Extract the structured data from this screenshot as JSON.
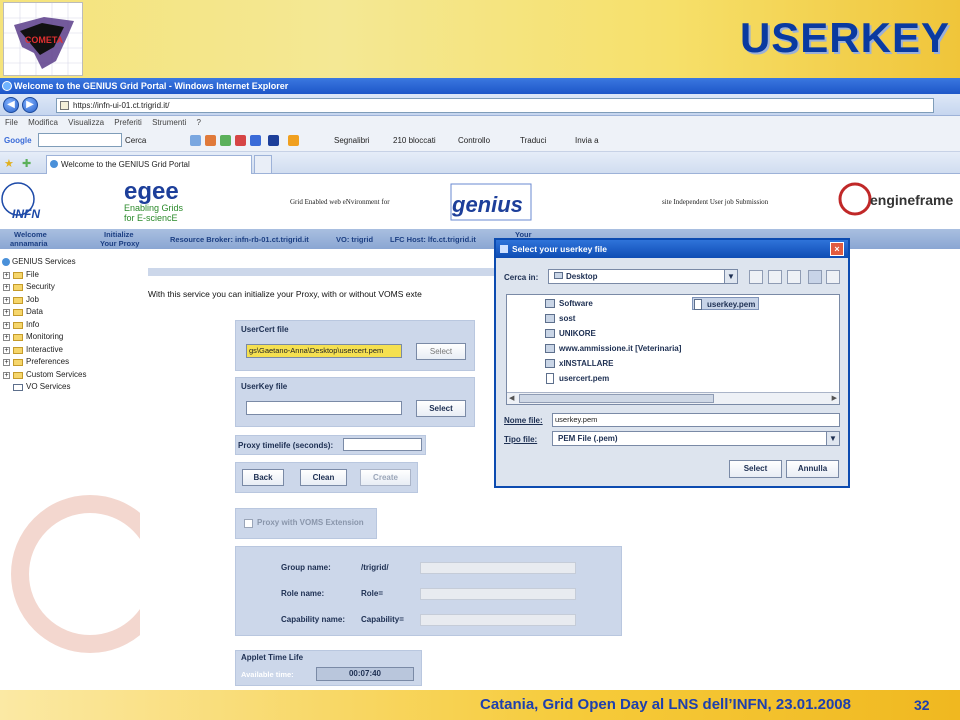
{
  "slide": {
    "title": "USERKEY",
    "footer": "Catania, Grid Open Day al LNS dell’INFN, 23.01.2008",
    "number": "32",
    "logo_text": "COMETA"
  },
  "browser": {
    "title": "Welcome to the GENIUS Grid Portal - Windows Internet Explorer",
    "url": "https://infn-ui-01.ct.trigrid.it/",
    "menu": [
      "File",
      "Modifica",
      "Visualizza",
      "Preferiti",
      "Strumenti",
      "?"
    ],
    "toolbar": {
      "google": "Google",
      "cerca": "Cerca",
      "segnalibri": "Segnalibri",
      "bloccati": "210 bloccati",
      "controllo": "Controllo",
      "traduci": "Traduci",
      "invia": "Invia a"
    },
    "tab_title": "Welcome to the GENIUS Grid Portal"
  },
  "portal": {
    "logos": {
      "infn": "INFN",
      "egee_main": "egee",
      "egee_sub1": "Enabling Grids",
      "egee_sub2": "for E-sciencE",
      "genius_caption": "Grid Enabled web eNvironment for",
      "genius": "genius",
      "genius_caption2": "site Independent User job Submission",
      "engine": "engineframe"
    },
    "nav": {
      "welcome": "Welcome",
      "user": "annamaria",
      "initialize": "Initialize",
      "your_proxy": "Your Proxy",
      "broker": "Resource Broker: infn-rb-01.ct.trigrid.it",
      "vo": "VO: trigrid",
      "lfc": "LFC Host: lfc.ct.trigrid.it",
      "your": "Your"
    },
    "tree": {
      "root": "GENIUS Services",
      "items": [
        "File",
        "Security",
        "Job",
        "Data",
        "Info",
        "Monitoring",
        "Interactive",
        "Preferences",
        "Custom Services"
      ],
      "leaf": "VO Services"
    },
    "intro": "With this service you can initialize your Proxy, with or without VOMS exte",
    "usercert": {
      "title": "UserCert file",
      "value": "gs\\Gaetano-Anna\\Desktop\\usercert.pem",
      "button": "Select"
    },
    "userkey": {
      "title": "UserKey file",
      "value": "",
      "button": "Select"
    },
    "lifetime_label": "Proxy timelife (seconds):",
    "buttons": {
      "back": "Back",
      "clean": "Clean",
      "create": "Create"
    },
    "voms_checkbox": "Proxy with VOMS Extension",
    "voms": {
      "group_label": "Group name:",
      "group_value": "/trigrid/",
      "role_label": "Role name:",
      "role_value": "Role=",
      "capability_label": "Capability name:",
      "capability_value": "Capability="
    },
    "applet": {
      "title": "Applet Time Life",
      "available": "Available time:",
      "time": "00:07:40"
    }
  },
  "dialog": {
    "title": "Select your userkey file",
    "look_in_label": "Cerca in:",
    "look_in_value": "Desktop",
    "files": [
      "Software",
      "sost",
      "UNIKORE",
      "www.ammissione.it [Veterinaria]",
      "xINSTALLARE",
      "usercert.pem"
    ],
    "selected_file": "userkey.pem",
    "filename_label": "Nome file:",
    "filename_value": "userkey.pem",
    "filetype_label": "Tipo file:",
    "filetype_value": "PEM File (.pem)",
    "select_button": "Select",
    "cancel_button": "Annulla"
  }
}
